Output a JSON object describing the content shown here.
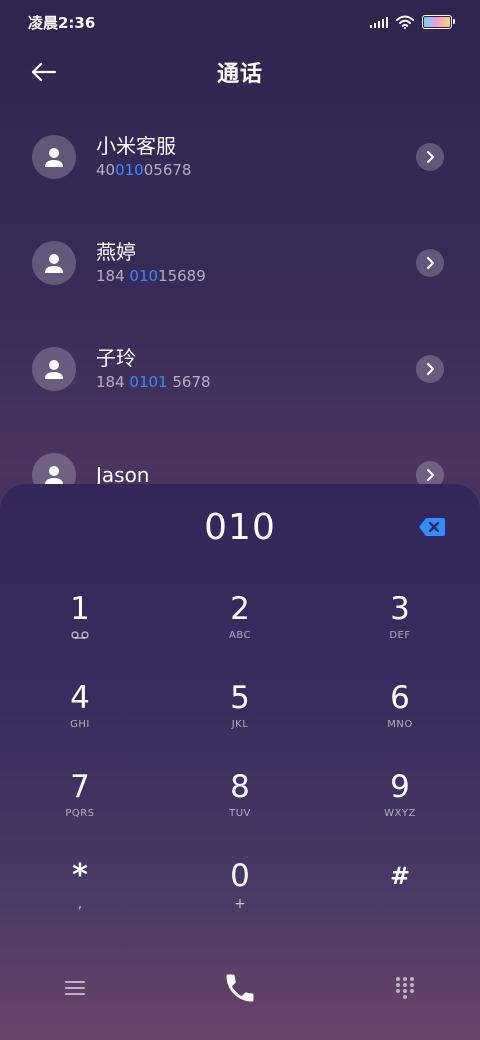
{
  "status": {
    "time": "凌晨2:36"
  },
  "header": {
    "title": "通话"
  },
  "contacts": [
    {
      "name": "小米客服",
      "number_parts": [
        "40",
        "010",
        "05678"
      ]
    },
    {
      "name": "燕婷",
      "number_parts": [
        "184 ",
        "010",
        "15689"
      ]
    },
    {
      "name": "子玲",
      "number_parts": [
        "184 ",
        "0101",
        " 5678"
      ]
    },
    {
      "name": "Jason",
      "number_parts": [
        "",
        "",
        ""
      ]
    }
  ],
  "dialer": {
    "input": "010",
    "keys": [
      {
        "digit": "1",
        "letters": ""
      },
      {
        "digit": "2",
        "letters": "ABC"
      },
      {
        "digit": "3",
        "letters": "DEF"
      },
      {
        "digit": "4",
        "letters": "GHI"
      },
      {
        "digit": "5",
        "letters": "JKL"
      },
      {
        "digit": "6",
        "letters": "MNO"
      },
      {
        "digit": "7",
        "letters": "PQRS"
      },
      {
        "digit": "8",
        "letters": "TUV"
      },
      {
        "digit": "9",
        "letters": "WXYZ"
      },
      {
        "digit": "*",
        "letters": ","
      },
      {
        "digit": "0",
        "letters": "+"
      },
      {
        "digit": "#",
        "letters": ""
      }
    ]
  },
  "colors": {
    "highlight": "#2f8fff",
    "backspace": "#2f8fff"
  },
  "icons": {
    "back": "arrow-left-icon",
    "avatar": "person-icon",
    "detail": "chevron-right-icon",
    "backspace": "backspace-icon",
    "voicemail": "voicemail-icon",
    "menu": "menu-icon",
    "call": "phone-icon",
    "keypad": "keypad-grid-icon"
  }
}
